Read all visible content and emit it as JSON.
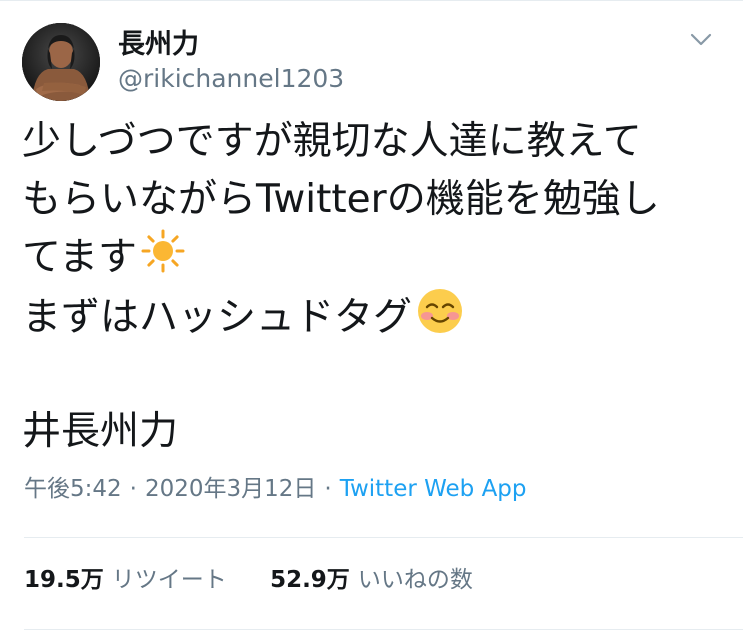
{
  "user": {
    "display_name": "長州力",
    "handle": "@rikichannel1203",
    "avatar_icon": "avatar-photo"
  },
  "menu": {
    "icon": "chevron-down-icon"
  },
  "tweet": {
    "lines": [
      "少しづつですが親切な人達に教えて",
      "もらいながらTwitterの機能を勉強し",
      "てます",
      "まずはハッシュドタグ",
      "井長州力"
    ],
    "emojis": [
      "sun-emoji",
      "smiling-face-emoji"
    ]
  },
  "meta": {
    "time": "午後5:42",
    "separator": "·",
    "date": "2020年3月12日",
    "source": "Twitter Web App"
  },
  "stats": {
    "retweets_value": "19.5万",
    "retweets_label": "リツイート",
    "likes_value": "52.9万",
    "likes_label": "いいねの数"
  },
  "colors": {
    "text": "#14171a",
    "secondary": "#657786",
    "link": "#1da1f2",
    "divider": "#e6ecf0"
  }
}
